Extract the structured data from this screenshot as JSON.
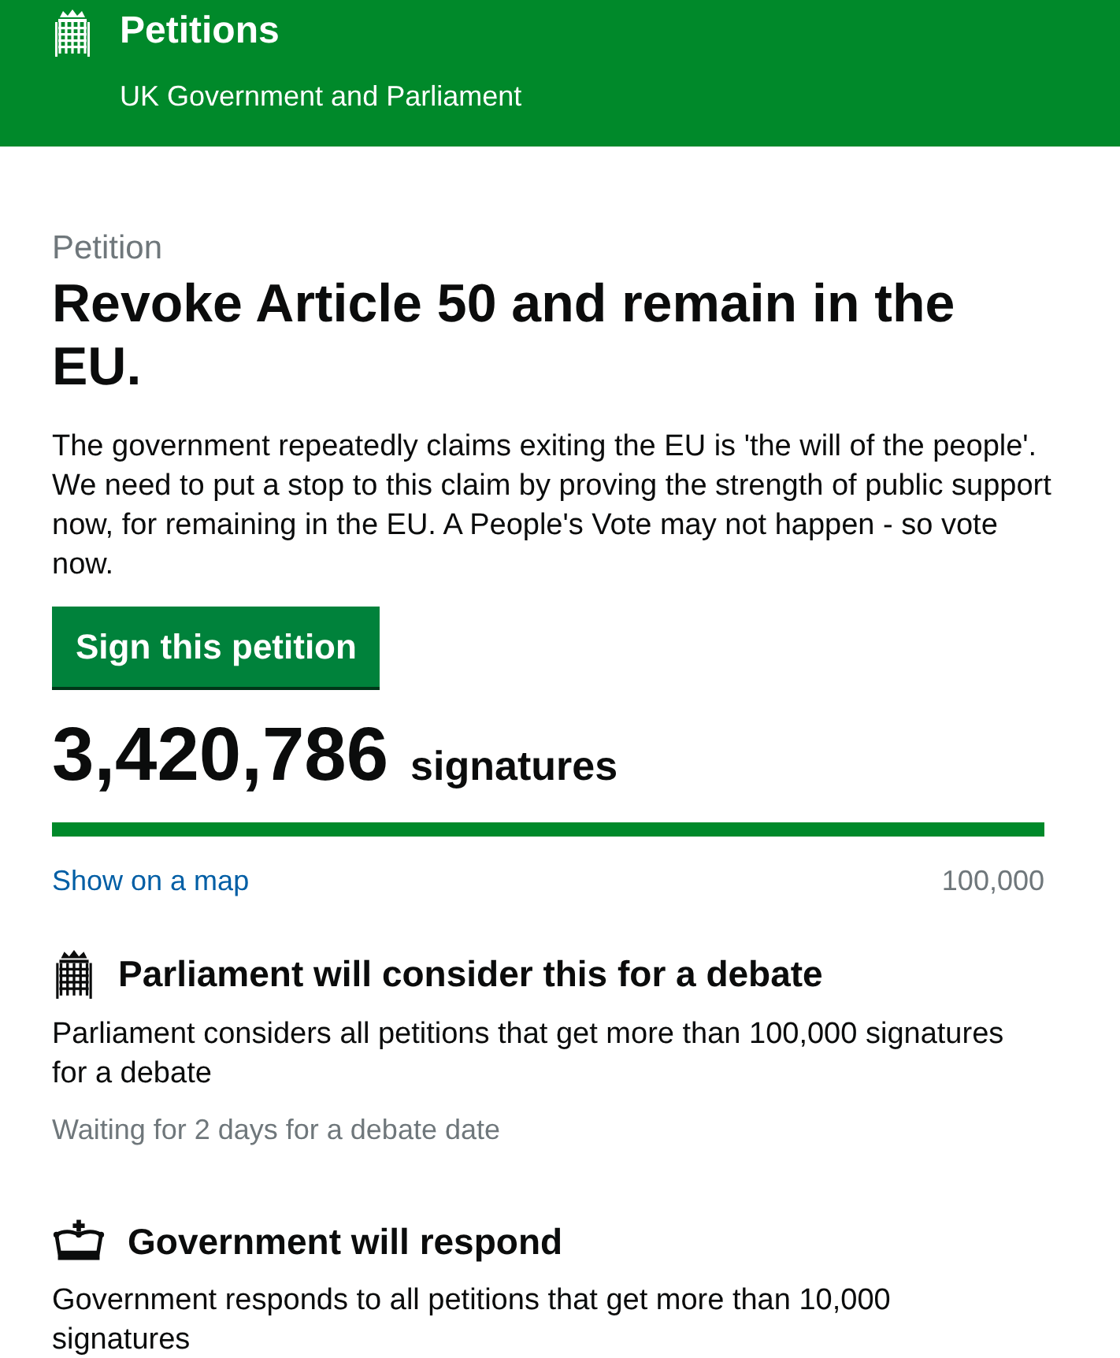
{
  "header": {
    "title": "Petitions",
    "subtitle": "UK Government and Parliament"
  },
  "petition": {
    "label": "Petition",
    "title": "Revoke Article 50 and remain in the EU.",
    "description": "The government repeatedly claims exiting the EU is 'the will of the people'. We need to put a stop to this claim by proving the strength of public support now, for remaining in the EU. A People's Vote may not happen - so vote now.",
    "sign_button": "Sign this petition"
  },
  "signatures": {
    "count": "3,420,786",
    "unit": "signatures",
    "level": 1,
    "map_link": "Show on a map",
    "threshold": "100,000"
  },
  "sections": [
    {
      "kind": "portcullis",
      "heading": "Parliament will consider this for a debate",
      "text": "Parliament considers all petitions that get more than 100,000 signatures for a debate",
      "note": "Waiting for 2 days for a debate date"
    },
    {
      "kind": "crown",
      "heading": "Government will respond",
      "text": "Government responds to all petitions that get more than 10,000 signatures"
    }
  ]
}
